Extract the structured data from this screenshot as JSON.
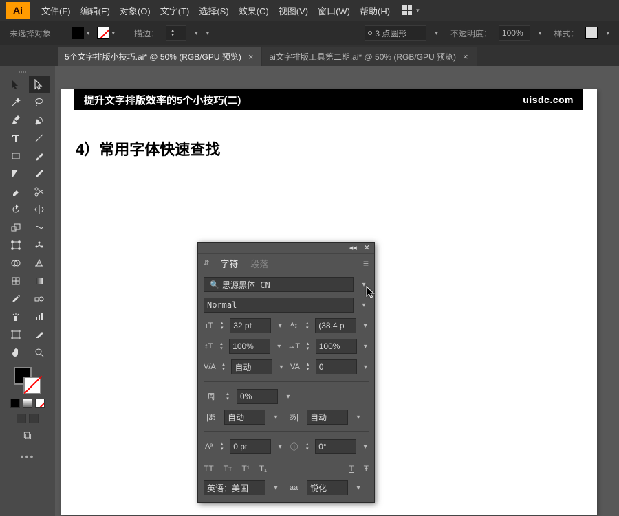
{
  "app": {
    "logo": "Ai"
  },
  "menu": {
    "file": "文件(F)",
    "edit": "编辑(E)",
    "object": "对象(O)",
    "type": "文字(T)",
    "select": "选择(S)",
    "effect": "效果(C)",
    "view": "视图(V)",
    "window": "窗口(W)",
    "help": "帮助(H)"
  },
  "ctrl": {
    "none_selected": "未选择对象",
    "stroke_label": "描边：",
    "stroke_options": "3 点圆形",
    "opacity_label": "不透明度：",
    "opacity_value": "100%",
    "style_label": "样式："
  },
  "tabs": {
    "a": "5个文字排版小技巧.ai* @ 50% (RGB/GPU 预览)",
    "b": "ai文字排版工具第二期.ai* @ 50% (RGB/GPU 预览)"
  },
  "doc": {
    "banner_title": "提升文字排版效率的5个小技巧(二)",
    "banner_brand": "uisdc.com",
    "heading": "4）常用字体快速查找"
  },
  "panel": {
    "tab_char": "字符",
    "tab_para": "段落",
    "font_family": "思源黑体 CN",
    "font_style": "Normal",
    "size": "32 pt",
    "leading": "(38.4 p",
    "hscale": "100%",
    "vscale": "100%",
    "kerning": "自动",
    "tracking": "0",
    "baseline_pct": "0%",
    "baseline_a": "自动",
    "baseline_b": "自动",
    "bshift": "0 pt",
    "rotation": "0°",
    "caps": {
      "allcaps": "TT",
      "smallcaps": "Tᴛ",
      "sup": "T¹",
      "sub": "T₁",
      "under": "T",
      "strike": "Ŧ"
    },
    "language": "英语：美国",
    "aa_label": "aa",
    "aa_value": "锐化"
  }
}
